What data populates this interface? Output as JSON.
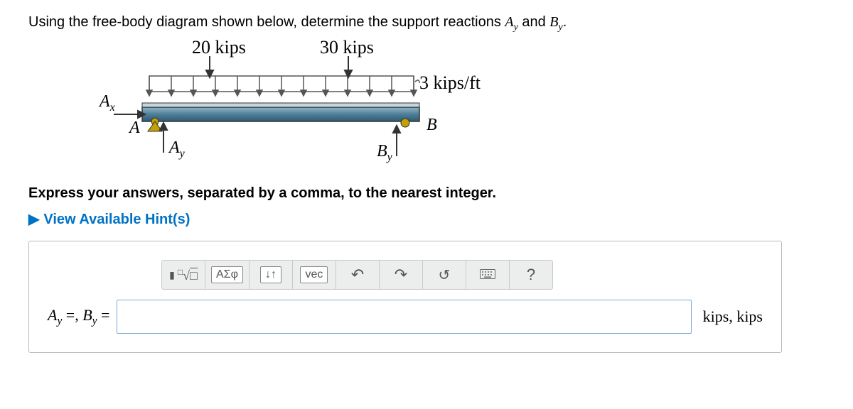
{
  "question_prefix": "Using the free-body diagram shown below, determine the support reactions ",
  "question_varA": "A",
  "question_varA_sub": "y",
  "question_mid": " and ",
  "question_varB": "B",
  "question_varB_sub": "y",
  "question_suffix": ".",
  "diagram": {
    "load1": "20 kips",
    "load2": "30 kips",
    "dist_load": "3 kips/ft",
    "Ax": "A",
    "Ax_sub": "x",
    "A_label": "A",
    "Ay": "A",
    "Ay_sub": "y",
    "B_label": "B",
    "By": "B",
    "By_sub": "y"
  },
  "instruction": "Express your answers, separated by a comma, to the nearest integer.",
  "hints_label": "View Available Hint(s)",
  "toolbar": {
    "templates_icon": "▮",
    "math_label": "ΑΣφ",
    "subsup": "↓↑",
    "vec": "vec",
    "undo": "↶",
    "redo": "↷",
    "reset": "↺",
    "keyboard": "⌨",
    "help": "?"
  },
  "answer": {
    "lhs_A": "A",
    "lhs_A_sub": "y",
    "lhs_eq1": " =, ",
    "lhs_B": "B",
    "lhs_B_sub": "y",
    "lhs_eq2": " = ",
    "value": "",
    "units": "kips, kips"
  }
}
